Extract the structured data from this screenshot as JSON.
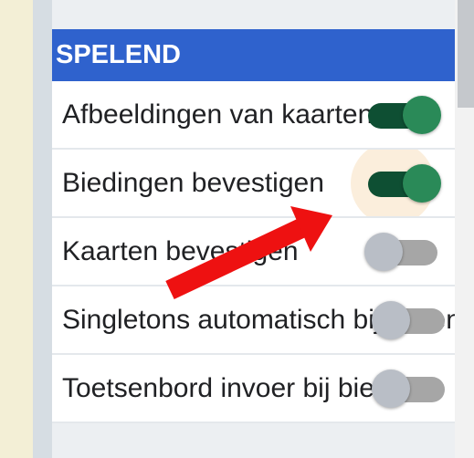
{
  "section": {
    "title": "SPELEND",
    "rows": [
      {
        "label": "Afbeeldingen van kaarten",
        "on": true
      },
      {
        "label": "Biedingen bevestigen",
        "on": true
      },
      {
        "label": "Kaarten bevestigen",
        "on": false
      },
      {
        "label": "Singletons automatisch bijspelen",
        "on": false
      },
      {
        "label": "Toetsenbord invoer bij bieden",
        "on": false
      }
    ]
  },
  "colors": {
    "header_bg": "#2f62cd",
    "toggle_on_knob": "#2a8a58",
    "toggle_off_knob": "#b9bec6",
    "annotation_arrow": "#ee1111"
  },
  "annotation": {
    "type": "red-arrow",
    "points_to": "Biedingen bevestigen toggle"
  }
}
